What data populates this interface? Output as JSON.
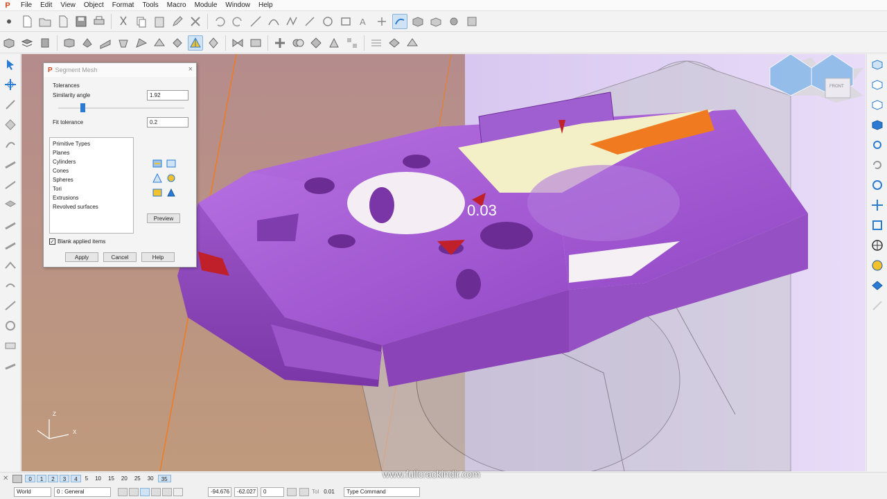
{
  "menu": [
    "File",
    "Edit",
    "View",
    "Object",
    "Format",
    "Tools",
    "Macro",
    "Module",
    "Window",
    "Help"
  ],
  "dialog": {
    "title": "Segment Mesh",
    "close": "×",
    "tolerances_label": "Tolerances",
    "similarity_label": "Similarity angle",
    "similarity_value": "1.92",
    "fit_label": "Fit tolerance",
    "fit_value": "0.2",
    "primitive_types": [
      "Primitive Types",
      "Planes",
      "Cylinders",
      "Cones",
      "Spheres",
      "Tori",
      "Extrusions",
      "Revolved surfaces"
    ],
    "preview_label": "Preview",
    "blank_label": "Blank applied items",
    "blank_checked": "✓",
    "apply_label": "Apply",
    "cancel_label": "Cancel",
    "help_label": "Help"
  },
  "viewport": {
    "measure_value": "0.03",
    "axis_z": "Z",
    "axis_x": "X",
    "cube_face": "FRONT"
  },
  "status": {
    "layers": [
      "0",
      "1",
      "2",
      "3",
      "4",
      "5",
      "10",
      "15",
      "20",
      "25",
      "30",
      "35"
    ],
    "active_layers": [
      "0",
      "1",
      "2",
      "3",
      "4",
      "35"
    ]
  },
  "command": {
    "world": "World",
    "layer": "0 : General",
    "x": "-94.676",
    "y": "-62.027",
    "z": "0",
    "tol_label": "Tol",
    "tol_value": "0.01",
    "type_command": "Type Command"
  },
  "watermark": "www.fullcrackindir.com",
  "colors": {
    "mesh": "#a45fc9",
    "accent": "#2a7bd3",
    "viewport_bg": "#c8b0cc",
    "deviation_red": "#c0202a",
    "deviation_orange": "#f07a20"
  }
}
